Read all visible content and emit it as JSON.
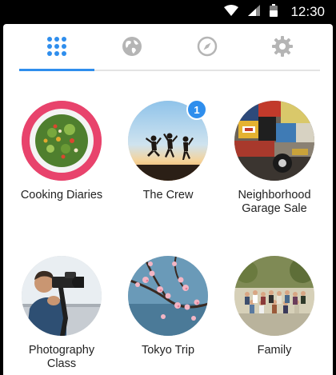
{
  "status_bar": {
    "time": "12:30"
  },
  "tabs": [
    {
      "icon": "grid-icon",
      "active": true
    },
    {
      "icon": "globe-icon",
      "active": false
    },
    {
      "icon": "compass-icon",
      "active": false
    },
    {
      "icon": "gear-icon",
      "active": false
    }
  ],
  "colors": {
    "accent": "#2f8eed",
    "ring_pink": "#e8436c"
  },
  "groups": [
    {
      "label": "Cooking Diaries",
      "image": "salad-bowl-photo",
      "badge": null
    },
    {
      "label": "The Crew",
      "image": "friends-jumping-sunset-photo",
      "badge": "1"
    },
    {
      "label": "Neighborhood Garage Sale",
      "image": "garage-sale-photo",
      "badge": null
    },
    {
      "label": "Photography Class",
      "image": "photographer-photo",
      "badge": null
    },
    {
      "label": "Tokyo Trip",
      "image": "cherry-blossom-photo",
      "badge": null
    },
    {
      "label": "Family",
      "image": "family-group-photo",
      "badge": null
    }
  ]
}
